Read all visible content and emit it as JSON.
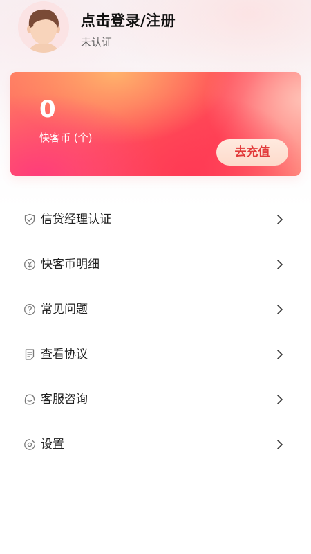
{
  "profile": {
    "avatar": "default-avatar",
    "login_title": "点击登录/注册",
    "verify_status": "未认证"
  },
  "coin_card": {
    "count": "0",
    "label": "快客币 (个)",
    "recharge_label": "去充值"
  },
  "menu": [
    {
      "label": "信贷经理认证",
      "icon": "shield-check-icon"
    },
    {
      "label": "快客币明细",
      "icon": "yen-coin-icon"
    },
    {
      "label": "常见问题",
      "icon": "question-circle-icon"
    },
    {
      "label": "查看协议",
      "icon": "document-icon"
    },
    {
      "label": "客服咨询",
      "icon": "headset-icon"
    },
    {
      "label": "设置",
      "icon": "settings-icon"
    }
  ],
  "colors": {
    "accent": "#ff4d5a",
    "recharge_text": "#e23a3a",
    "icon_gray": "#777777"
  }
}
